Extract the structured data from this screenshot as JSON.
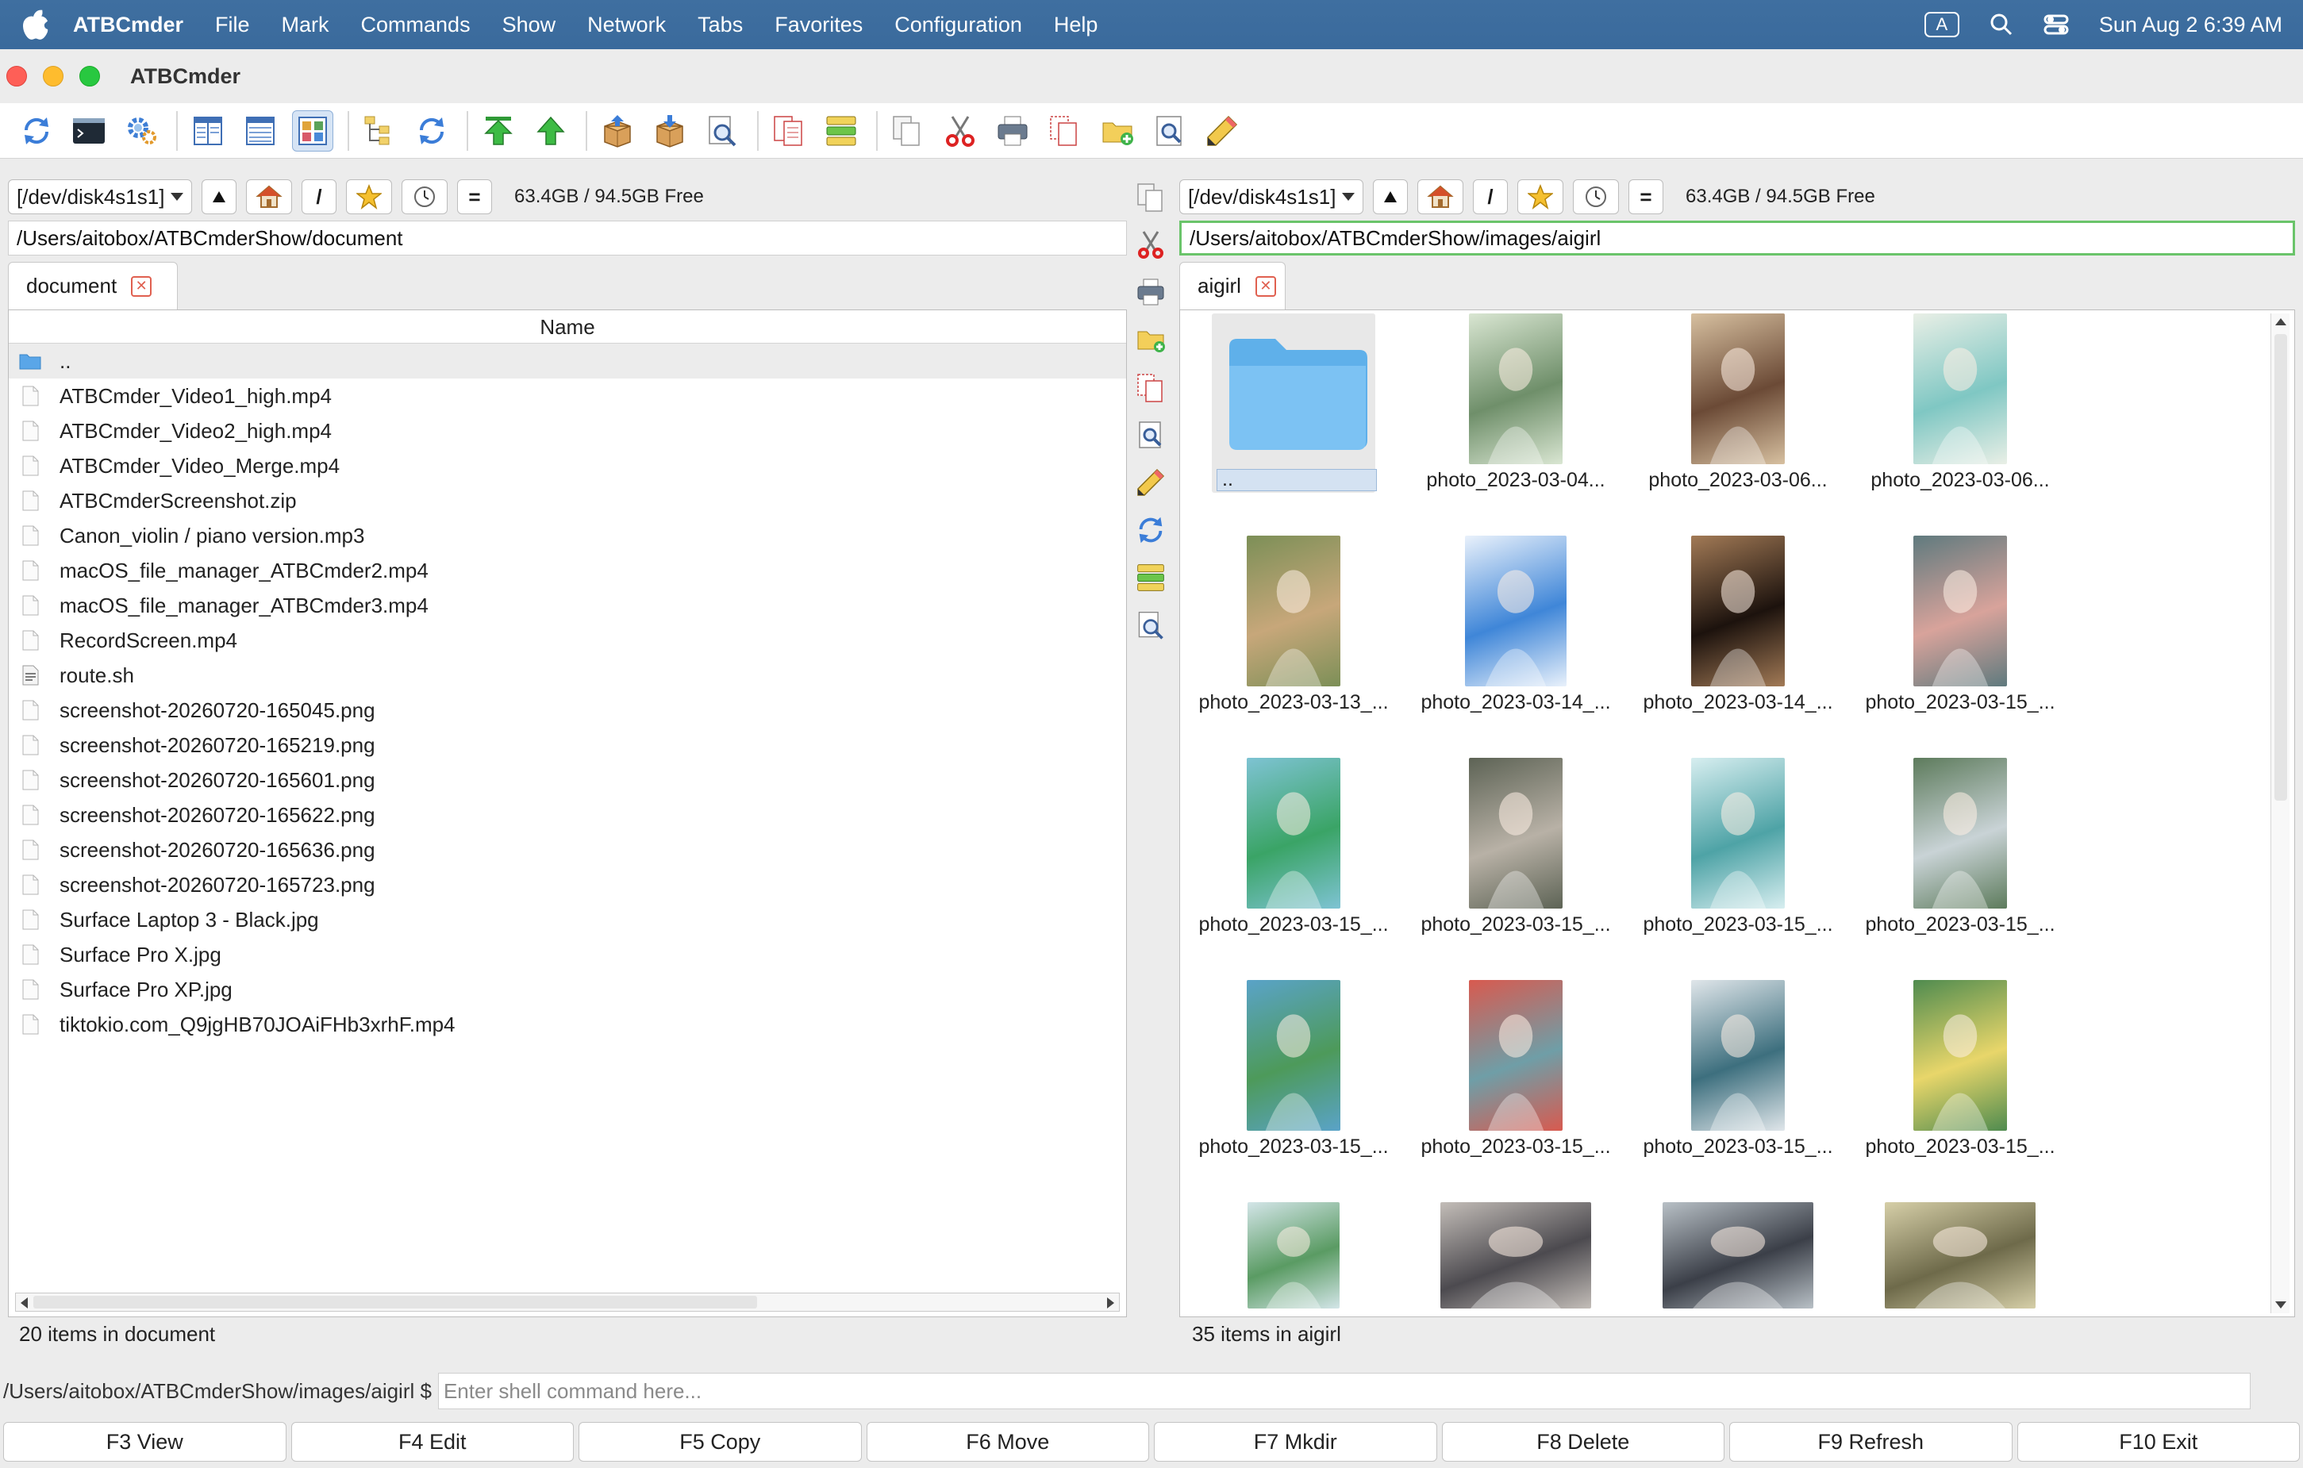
{
  "menubar": {
    "app_name": "ATBCmder",
    "items": [
      "File",
      "Mark",
      "Commands",
      "Show",
      "Network",
      "Tabs",
      "Favorites",
      "Configuration",
      "Help"
    ],
    "input_indicator": "A",
    "clock": "Sun Aug 2  6:39 AM"
  },
  "window": {
    "title": "ATBCmder"
  },
  "left": {
    "drive": "[/dev/disk4s1s1]",
    "root_label": "/",
    "equal_label": "=",
    "free": "63.4GB / 94.5GB Free",
    "path": "/Users/aitobox/ATBCmderShow/document",
    "tab": "document",
    "column_name": "Name",
    "files": [
      {
        "name": "..",
        "kind": "folder"
      },
      {
        "name": "ATBCmder_Video1_high.mp4",
        "kind": "file"
      },
      {
        "name": "ATBCmder_Video2_high.mp4",
        "kind": "file"
      },
      {
        "name": "ATBCmder_Video_Merge.mp4",
        "kind": "file"
      },
      {
        "name": "ATBCmderScreenshot.zip",
        "kind": "file"
      },
      {
        "name": "Canon_violin / piano version.mp3",
        "kind": "file"
      },
      {
        "name": "macOS_file_manager_ATBCmder2.mp4",
        "kind": "file"
      },
      {
        "name": "macOS_file_manager_ATBCmder3.mp4",
        "kind": "file"
      },
      {
        "name": "RecordScreen.mp4",
        "kind": "file"
      },
      {
        "name": "route.sh",
        "kind": "script"
      },
      {
        "name": "screenshot-20260720-165045.png",
        "kind": "file"
      },
      {
        "name": "screenshot-20260720-165219.png",
        "kind": "file"
      },
      {
        "name": "screenshot-20260720-165601.png",
        "kind": "file"
      },
      {
        "name": "screenshot-20260720-165622.png",
        "kind": "file"
      },
      {
        "name": "screenshot-20260720-165636.png",
        "kind": "file"
      },
      {
        "name": "screenshot-20260720-165723.png",
        "kind": "file"
      },
      {
        "name": "Surface Laptop 3 - Black.jpg",
        "kind": "file"
      },
      {
        "name": "Surface Pro X.jpg",
        "kind": "file"
      },
      {
        "name": "Surface Pro XP.jpg",
        "kind": "file"
      },
      {
        "name": "tiktokio.com_Q9jgHB70JOAiFHb3xrhF.mp4",
        "kind": "file"
      }
    ],
    "status": "20 items in document"
  },
  "right": {
    "drive": "[/dev/disk4s1s1]",
    "root_label": "/",
    "equal_label": "=",
    "free": "63.4GB / 94.5GB Free",
    "path": "/Users/aitobox/ATBCmderShow/images/aigirl",
    "tab": "aigirl",
    "thumbs": [
      {
        "caption": "..",
        "kind": "folder"
      },
      {
        "caption": "photo_2023-03-04...",
        "c1": "#6f8f6a",
        "c2": "#d9e6d2"
      },
      {
        "caption": "photo_2023-03-06...",
        "c1": "#6b4a36",
        "c2": "#d7c0a0"
      },
      {
        "caption": "photo_2023-03-06...",
        "c1": "#7fc7c3",
        "c2": "#e9efe6"
      },
      {
        "caption": "photo_2023-03-13_...",
        "c1": "#c7a77a",
        "c2": "#7c8f57"
      },
      {
        "caption": "photo_2023-03-14_...",
        "c1": "#3f86d8",
        "c2": "#e9f1fb"
      },
      {
        "caption": "photo_2023-03-14_...",
        "c1": "#1c120d",
        "c2": "#a27a56"
      },
      {
        "caption": "photo_2023-03-15_...",
        "c1": "#d8a39b",
        "c2": "#5f7a7e"
      },
      {
        "caption": "photo_2023-03-15_...",
        "c1": "#3aa466",
        "c2": "#7ec3d3"
      },
      {
        "caption": "photo_2023-03-15_...",
        "c1": "#b8b1a6",
        "c2": "#5d6355"
      },
      {
        "caption": "photo_2023-03-15_...",
        "c1": "#4ea3a6",
        "c2": "#d7eef0"
      },
      {
        "caption": "photo_2023-03-15_...",
        "c1": "#c9d3d6",
        "c2": "#5d7b5c"
      },
      {
        "caption": "photo_2023-03-15_...",
        "c1": "#4d9a5a",
        "c2": "#5aa3c8"
      },
      {
        "caption": "photo_2023-03-15_...",
        "c1": "#6f9ea7",
        "c2": "#d85a4f"
      },
      {
        "caption": "photo_2023-03-15_...",
        "c1": "#3d6f7e",
        "c2": "#e0e6ea"
      },
      {
        "caption": "photo_2023-03-15_...",
        "c1": "#e8d66a",
        "c2": "#4f8b4f"
      },
      {
        "caption": "",
        "c1": "#5a9b63",
        "c2": "#d3e5e8"
      },
      {
        "caption": "",
        "c1": "#4c4a4f",
        "c2": "#c3bdb8"
      },
      {
        "caption": "",
        "c1": "#3b3f48",
        "c2": "#b8c0c6"
      },
      {
        "caption": "",
        "c1": "#6e6a4a",
        "c2": "#d6cfa8"
      }
    ],
    "status": "35 items in aigirl"
  },
  "cmd": {
    "prompt": "/Users/aitobox/ATBCmderShow/images/aigirl $",
    "placeholder": "Enter shell command here..."
  },
  "fkeys": [
    "F3 View",
    "F4 Edit",
    "F5 Copy",
    "F6 Move",
    "F7 Mkdir",
    "F8 Delete",
    "F9 Refresh",
    "F10 Exit"
  ]
}
